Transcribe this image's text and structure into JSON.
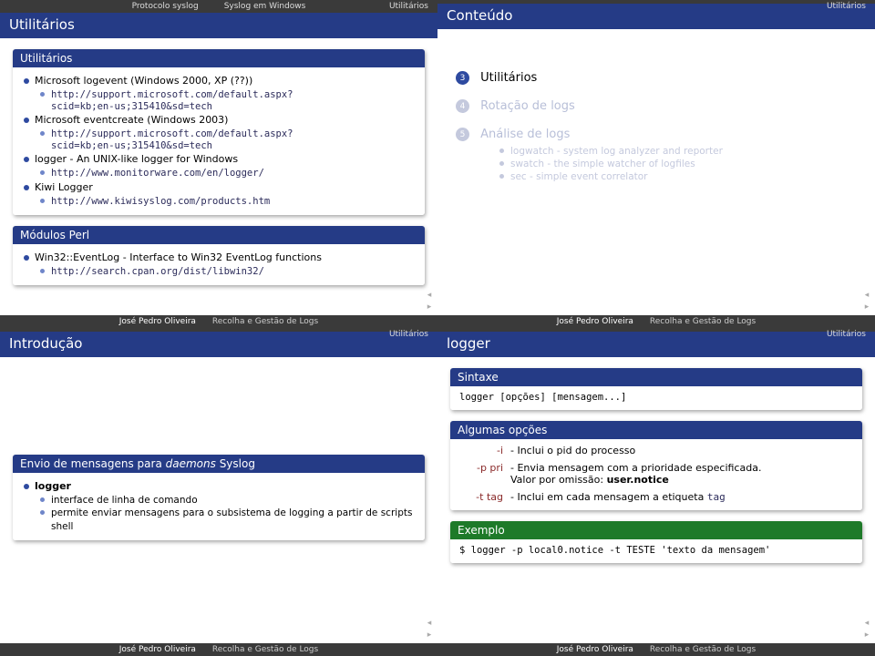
{
  "nav": {
    "items": [
      "Protocolo syslog",
      "Syslog em Windows",
      "Utilitários"
    ],
    "active2": "Utilitários"
  },
  "footer": {
    "author": "José Pedro Oliveira",
    "title": "Recolha e Gestão de Logs"
  },
  "s1": {
    "title": "Utilitários",
    "block1": {
      "head": "Utilitários",
      "i1": "Microsoft logevent (Windows 2000, XP (??))",
      "i1a": "http://support.microsoft.com/default.aspx?",
      "i1b": "scid=kb;en-us;315410&sd=tech",
      "i2": "Microsoft eventcreate (Windows 2003)",
      "i2a": "http://support.microsoft.com/default.aspx?",
      "i2b": "scid=kb;en-us;315410&sd=tech",
      "i3": "logger - An UNIX-like logger for Windows",
      "i3a": "http://www.monitorware.com/en/logger/",
      "i4": "Kiwi Logger",
      "i4a": "http://www.kiwisyslog.com/products.htm"
    },
    "block2": {
      "head": "Módulos Perl",
      "i1": "Win32::EventLog - Interface to Win32 EventLog functions",
      "i1a": "http://search.cpan.org/dist/libwin32/"
    }
  },
  "s2": {
    "title": "Conteúdo",
    "n3": "3",
    "t3": "Utilitários",
    "n4": "4",
    "t4": "Rotação de logs",
    "n5": "5",
    "t5": "Análise de logs",
    "a5a": "logwatch - system log analyzer and reporter",
    "a5b": "swatch - the simple watcher of logfiles",
    "a5c": "sec - simple event correlator"
  },
  "s3": {
    "title": "Introdução",
    "block": {
      "head": "Envio de mensagens para daemons Syslog",
      "daemons": "daemons",
      "i1": "logger",
      "i1a": "interface de linha de comando",
      "i1b": "permite enviar mensagens para o subsistema de logging a partir de scripts shell"
    }
  },
  "s4": {
    "title": "logger",
    "sintaxe": {
      "head": "Sintaxe",
      "line": "logger [opções] [mensagem...]"
    },
    "opcoes": {
      "head": "Algumas opções",
      "k1": "-i",
      "v1": "- Inclui o pid do processo",
      "k2": "-p pri",
      "v2a": "- Envia mensagem com a prioridade especificada.",
      "v2b": "Valor por omissão: ",
      "v2c": "user.notice",
      "k3": "-t tag",
      "v3a": "- Inclui em cada mensagem a etiqueta ",
      "v3b": "tag"
    },
    "ex": {
      "head": "Exemplo",
      "line": "$ logger -p local0.notice -t TESTE 'texto da mensagem'"
    }
  }
}
